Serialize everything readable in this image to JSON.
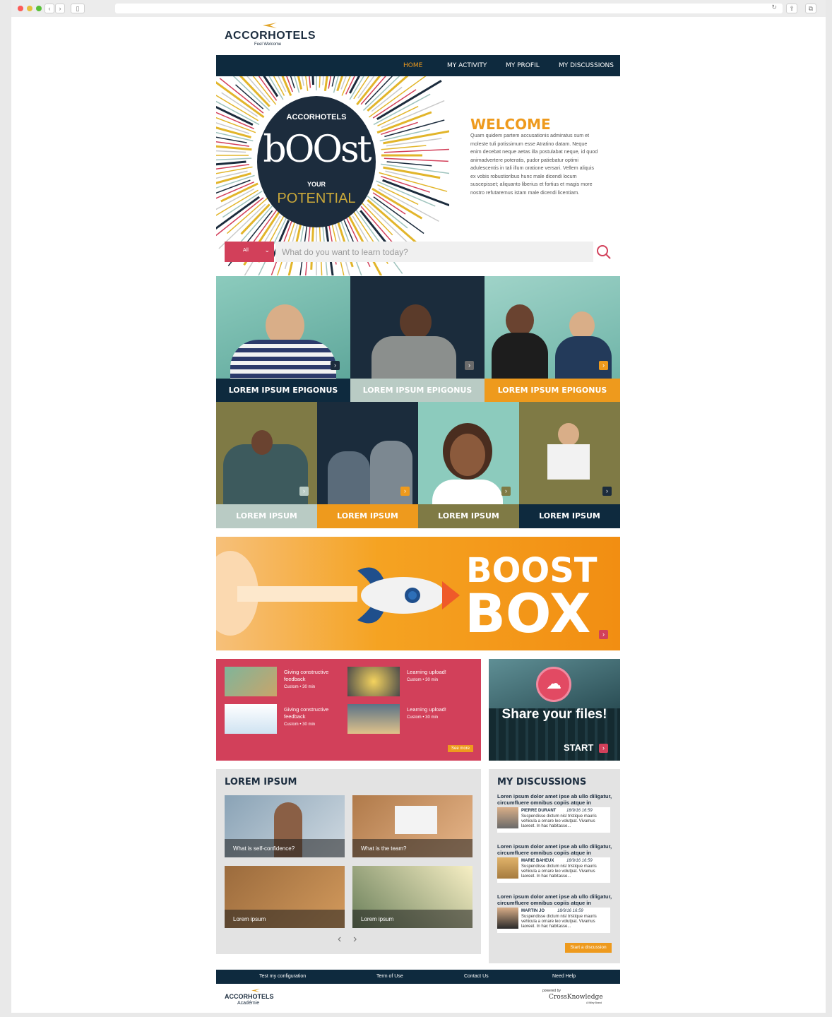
{
  "nav": {
    "items": [
      "HOME",
      "MY ACTIVITY",
      "MY PROFIL",
      "MY DISCUSSIONS"
    ]
  },
  "logo": {
    "brand": "ACCORHOTELS",
    "tagline": "Feel Welcome"
  },
  "hero": {
    "badge_brand": "ACCORHOTELS",
    "badge_title": "bOOst",
    "badge_your": "YOUR",
    "badge_potential": "POTENTIAL",
    "welcome_title": "WELCOME",
    "welcome_text": "Quam quidem partem accusationis admiratus sum et moleste tuli potissimum esse Atratino datam. Neque enim decebat neque aetas illa postulabat neque, id quod animadvertere poteratis, pudor patiebatur optimi adulescentis in tali illum oratione versari. Vellem aliquis ex vobis robustioribus hunc male dicendi locum suscepisset; aliquanto liberius et fortius et magis more nostro refutaremus istam male dicendi licentiam."
  },
  "search": {
    "filter": "All",
    "placeholder": "What do you want to learn today?"
  },
  "tiles_big": [
    {
      "label": "LOREM IPSUM EPIGONUS"
    },
    {
      "label": "LOREM IPSUM EPIGONUS"
    },
    {
      "label": "LOREM IPSUM EPIGONUS"
    }
  ],
  "tiles_small": [
    {
      "label": "LOREM IPSUM"
    },
    {
      "label": "LOREM IPSUM"
    },
    {
      "label": "LOREM IPSUM"
    },
    {
      "label": "LOREM IPSUM"
    }
  ],
  "boost_box": {
    "line1": "BOOST",
    "line2": "BOX"
  },
  "courses": [
    {
      "title": "Giving constructive feedback",
      "meta": "Custom • 30 min"
    },
    {
      "title": "Learning upload!",
      "meta": "Custom • 30 min"
    },
    {
      "title": "Giving constructive feedback",
      "meta": "Custom • 30 min"
    },
    {
      "title": "Learning upload!",
      "meta": "Custom • 30 min"
    }
  ],
  "see_more": "See more",
  "share": {
    "title": "Share your files!",
    "start": "START"
  },
  "lorem_section": {
    "title": "LOREM IPSUM",
    "cards": [
      "What is self-confidence?",
      "What is the team?",
      "Lorem ipsum",
      "Lorem ipsum"
    ]
  },
  "discussions": {
    "title": "MY DISCUSSIONS",
    "items": [
      {
        "question": "Loren ipsum dolor amet ipse ab ullo diligatur, circumfluere omnibus copiis atque in",
        "name": "PIERRE DURANT",
        "date": "18/9/16 16:59",
        "text": "Suspendisse dictum nisl tristique mauris vehicula a ornare leo volutpat. Vivamus laoreet. In hac habitasse..."
      },
      {
        "question": "Loren ipsum dolor amet ipse ab ullo diligatur, circumfluere omnibus copiis atque in",
        "name": "MARIE BAHEUX",
        "date": "18/9/16 16:59",
        "text": "Suspendisse dictum nisl tristique mauris vehicula a ornare leo volutpat. Vivamus laoreet. In hac habitasse..."
      },
      {
        "question": "Loren ipsum dolor amet ipse ab ullo diligatur, circumfluere omnibus copiis atque in",
        "name": "MARTIN JO",
        "date": "18/9/16 16:59",
        "text": "Suspendisse dictum nisl tristique mauris vehicula a ornare leo volutpat. Vivamus laoreet. In hac habitasse..."
      }
    ],
    "start_button": "Start a discussion"
  },
  "footer": {
    "links": [
      "Test my configuration",
      "Term of Use",
      "Contact Us",
      "Need Help"
    ],
    "academie": "Académie",
    "powered": "powered by",
    "ck": "CrossKnowledge",
    "ck_sub": "A Wiley Brand"
  },
  "colors": {
    "navy": "#0e2a3e",
    "orange": "#ee9a1d",
    "crimson": "#d2405a",
    "sage": "#b9cbc4",
    "olive": "#7f7a45"
  }
}
